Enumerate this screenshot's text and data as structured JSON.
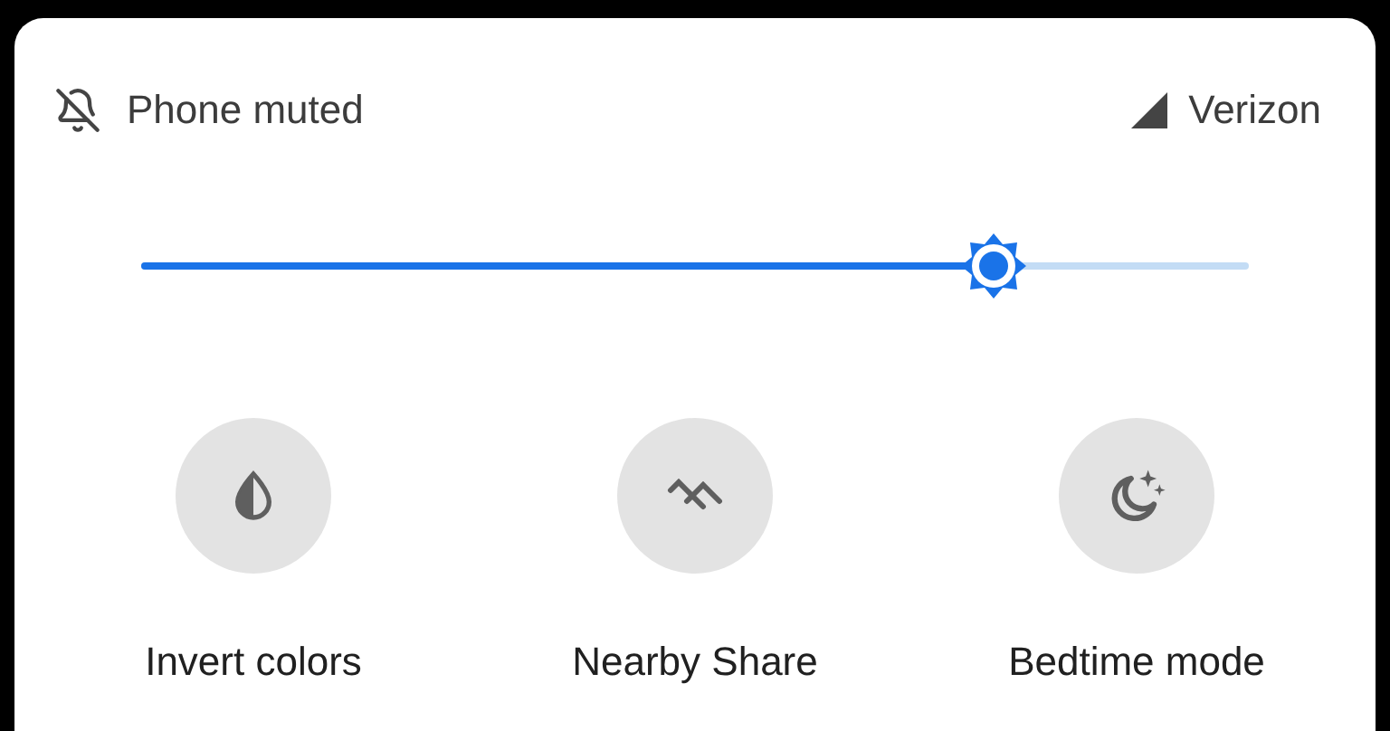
{
  "status_bar": {
    "left_label": "Phone muted",
    "right_label": "Verizon"
  },
  "brightness": {
    "level": 0.77
  },
  "tiles": [
    {
      "kind": "invert",
      "label": "Invert colors",
      "on": false
    },
    {
      "kind": "share",
      "label": "Nearby Share",
      "on": false
    },
    {
      "kind": "bedtime",
      "label": "Bedtime mode",
      "on": false
    }
  ]
}
